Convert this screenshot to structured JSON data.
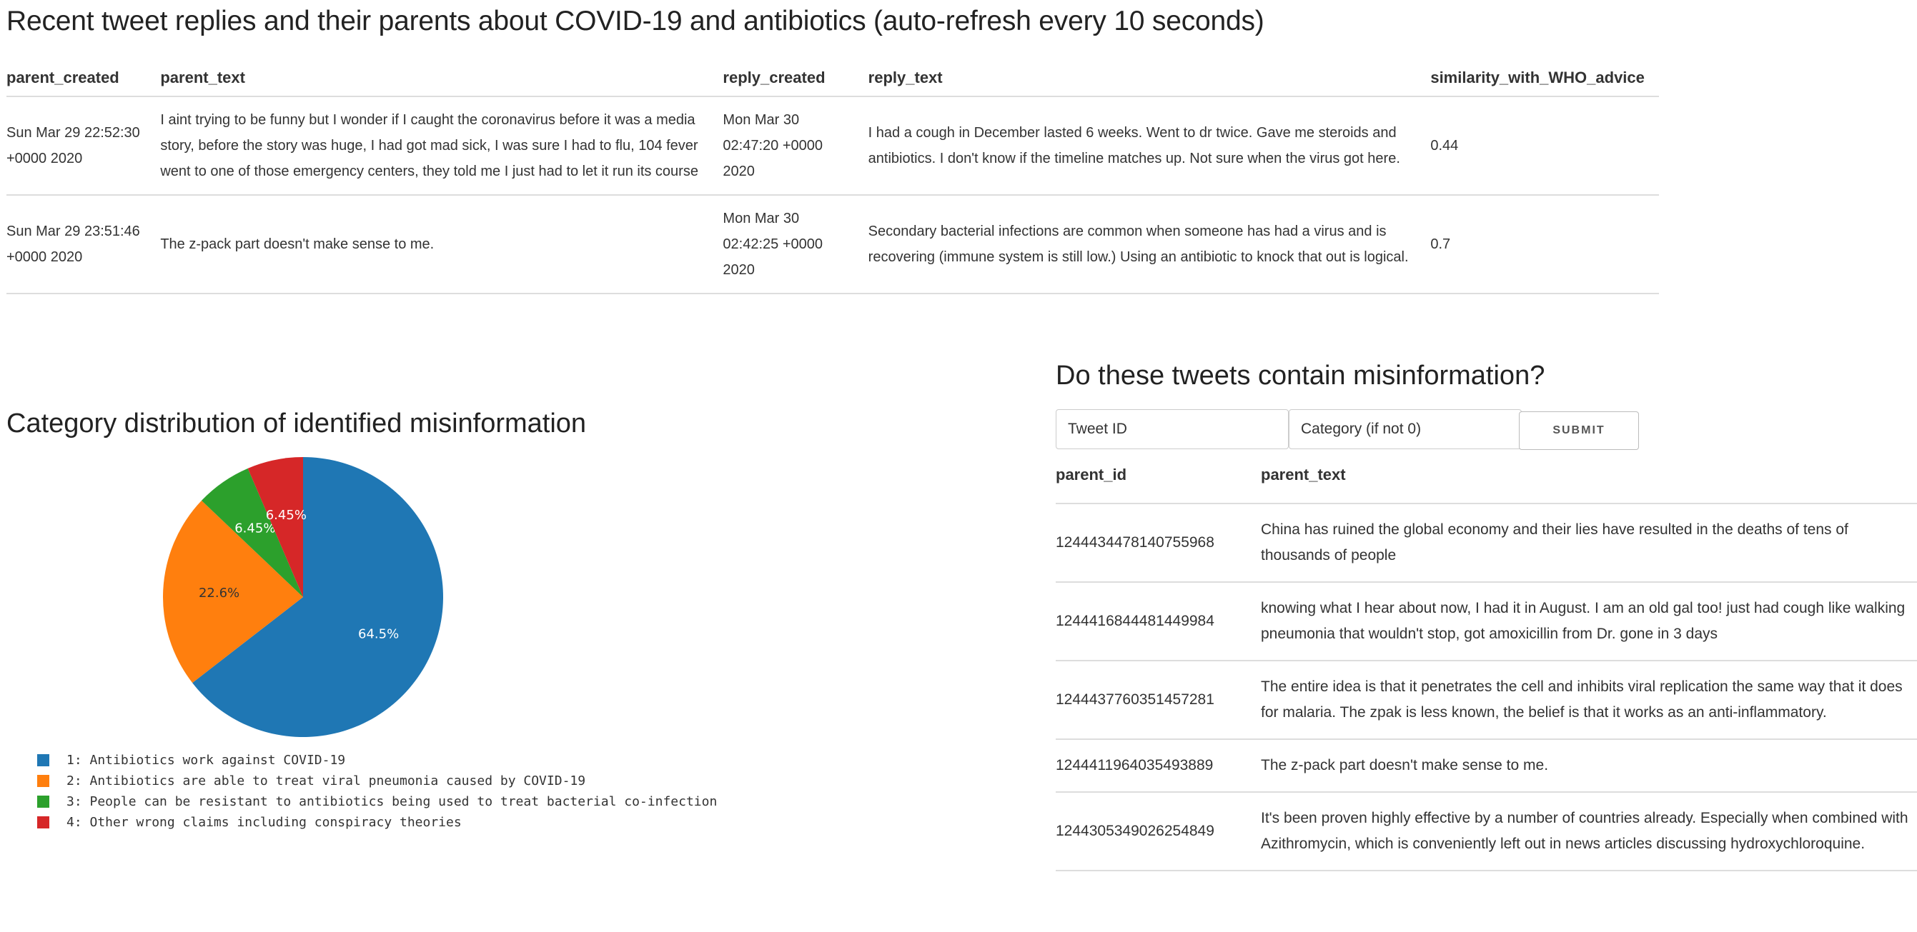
{
  "header": {
    "title": "Recent tweet replies and their parents about COVID-19 and antibiotics (auto-refresh every 10 seconds)"
  },
  "replies_table": {
    "columns": [
      "parent_created",
      "parent_text",
      "reply_created",
      "reply_text",
      "similarity_with_WHO_advice"
    ],
    "rows": [
      {
        "parent_created": "Sun Mar 29 22:52:30 +0000 2020",
        "parent_text": "I aint trying to be funny but I wonder if I caught the coronavirus before it was a media story, before the story was huge, I had got mad sick, I was sure I had to flu, 104 fever went to one of those emergency centers, they told me I just had to let it run its course",
        "reply_created": "Mon Mar 30 02:47:20 +0000 2020",
        "reply_text": "I had a cough in December lasted 6 weeks. Went to dr twice. Gave me steroids and antibiotics. I don't know if the timeline matches up. Not sure when the virus got here.",
        "similarity": "0.44"
      },
      {
        "parent_created": "Sun Mar 29 23:51:46 +0000 2020",
        "parent_text": "The z-pack part doesn't make sense to me.",
        "reply_created": "Mon Mar 30 02:42:25 +0000 2020",
        "reply_text": "Secondary bacterial infections are common when someone has had a virus and is recovering (immune system is still low.) Using an antibiotic to knock that out is logical.",
        "similarity": "0.7"
      }
    ]
  },
  "misinfo": {
    "title": "Do these tweets contain misinformation?",
    "tweet_id_placeholder": "Tweet ID",
    "category_placeholder": "Category (if not 0)",
    "submit_label": "SUBMIT",
    "columns": [
      "parent_id",
      "parent_text"
    ],
    "rows": [
      {
        "parent_id": "1244434478140755968",
        "parent_text": "China has ruined the global economy and their lies have resulted in the deaths of tens of thousands of people"
      },
      {
        "parent_id": "1244416844481449984",
        "parent_text": "knowing what I hear about now, I had it in August. I am an old gal too! just had cough like walking pneumonia that wouldn't stop, got amoxicillin from Dr. gone in 3 days"
      },
      {
        "parent_id": "1244437760351457281",
        "parent_text": "The entire idea is that it penetrates the cell and inhibits viral replication the same way that it does for malaria. The zpak is less known, the belief is that it works as an anti-inflammatory."
      },
      {
        "parent_id": "1244411964035493889",
        "parent_text": "The z-pack part doesn't make sense to me."
      },
      {
        "parent_id": "1244305349026254849",
        "parent_text": "It's been proven highly effective by a number of countries already. Especially when combined with Azithromycin, which is conveniently left out in news articles discussing hydroxychloroquine."
      }
    ]
  },
  "chart_data": {
    "type": "pie",
    "title": "Category distribution of identified misinformation",
    "categories": [
      "1: Antibiotics work against COVID-19",
      "2: Antibiotics are able to treat viral pneumonia caused by COVID-19",
      "3: People can be resistant to antibiotics being used to treat bacterial co-infection",
      "4: Other wrong claims including conspiracy theories"
    ],
    "values": [
      64.5,
      22.6,
      6.45,
      6.45
    ],
    "labels": [
      "64.5%",
      "22.6%",
      "6.45%",
      "6.45%"
    ],
    "colors": [
      "#1f77b4",
      "#ff7f0e",
      "#2ca02c",
      "#d62728"
    ],
    "label_colors": [
      "#ffffff",
      "#333333",
      "#ffffff",
      "#ffffff"
    ],
    "legend_position": "bottom-left"
  }
}
